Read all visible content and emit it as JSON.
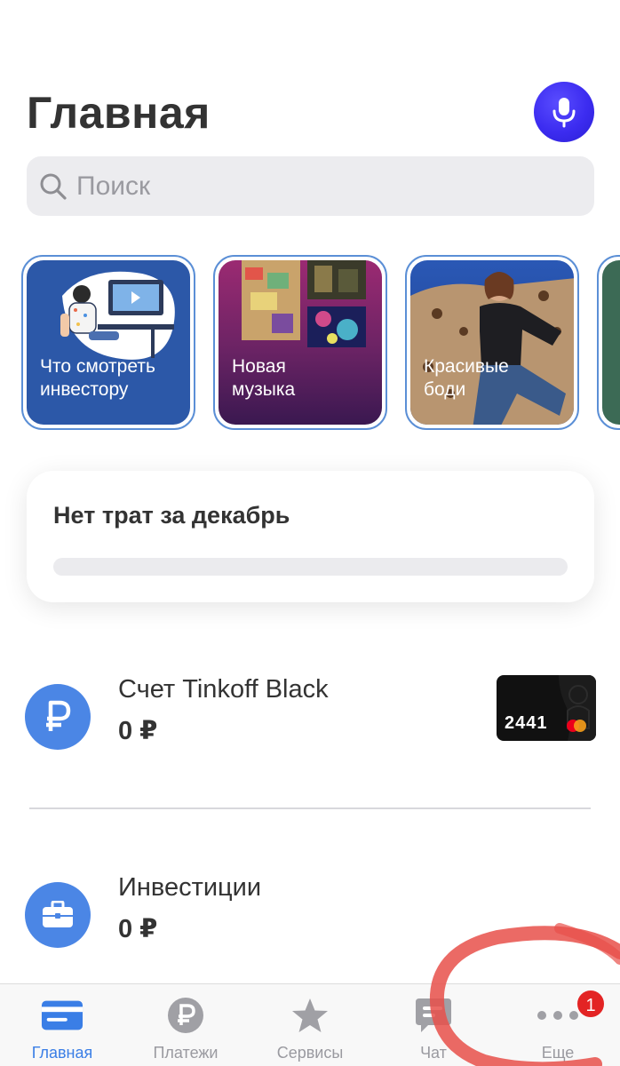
{
  "header": {
    "title": "Главная"
  },
  "search": {
    "placeholder": "Поиск"
  },
  "stories": [
    {
      "label": "Что смотреть\nинвестору"
    },
    {
      "label": "Новая\nмузыка"
    },
    {
      "label": "Красивые\nбоди"
    },
    {
      "label": ""
    }
  ],
  "spending": {
    "title": "Нет трат за декабрь",
    "progress": 0
  },
  "accounts": [
    {
      "name": "Счет Tinkoff Black",
      "amount": "0 ₽",
      "card_number": "2441"
    },
    {
      "name": "Инвестиции",
      "amount": "0 ₽"
    }
  ],
  "tabbar": {
    "items": [
      {
        "label": "Главная",
        "icon": "card-icon",
        "active": true
      },
      {
        "label": "Платежи",
        "icon": "ruble-icon",
        "active": false
      },
      {
        "label": "Сервисы",
        "icon": "star-icon",
        "active": false
      },
      {
        "label": "Чат",
        "icon": "chat-icon",
        "active": false
      },
      {
        "label": "Еще",
        "icon": "more-icon",
        "active": false
      }
    ],
    "badge": "1"
  },
  "colors": {
    "accent": "#3a7ee6",
    "mic": "#3c2cf0",
    "badge": "#e32424"
  }
}
